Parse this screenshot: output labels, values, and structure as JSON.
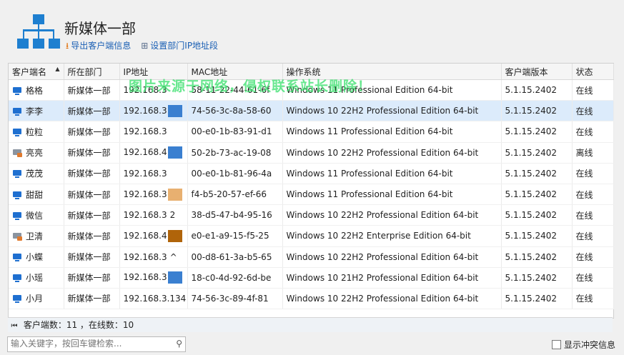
{
  "header": {
    "title": "新媒体一部",
    "export_label": "导出客户端信息",
    "ip_segment_label": "设置部门IP地址段"
  },
  "table": {
    "columns": [
      "客户端名",
      "所在部门",
      "IP地址",
      "MAC地址",
      "操作系统",
      "客户端版本",
      "状态"
    ],
    "rows": [
      {
        "name": "格格",
        "dept": "新媒体一部",
        "ip": "192.168.3",
        "mac": "58-11-22-44-61-6f",
        "os": "Windows 11 Professional Edition 64-bit",
        "ver": "5.1.15.2402",
        "status": "在线",
        "online": true,
        "mask": "",
        "ip_tail": ""
      },
      {
        "name": "李李",
        "dept": "新媒体一部",
        "ip": "192.168.3",
        "mac": "74-56-3c-8a-58-60",
        "os": "Windows 10 22H2 Professional Edition 64-bit",
        "ver": "5.1.15.2402",
        "status": "在线",
        "online": true,
        "mask": "#3a7fd0",
        "ip_tail": ""
      },
      {
        "name": "粒粒",
        "dept": "新媒体一部",
        "ip": "192.168.3",
        "mac": "00-e0-1b-83-91-d1",
        "os": "Windows 11 Professional Edition 64-bit",
        "ver": "5.1.15.2402",
        "status": "在线",
        "online": true,
        "mask": "",
        "ip_tail": ""
      },
      {
        "name": "亮亮",
        "dept": "新媒体一部",
        "ip": "192.168.4",
        "mac": "50-2b-73-ac-19-08",
        "os": "Windows 10 22H2 Professional Edition 64-bit",
        "ver": "5.1.15.2402",
        "status": "离线",
        "online": false,
        "mask": "#3a7fd0",
        "ip_tail": ""
      },
      {
        "name": "茂茂",
        "dept": "新媒体一部",
        "ip": "192.168.3",
        "mac": "00-e0-1b-81-96-4a",
        "os": "Windows 11 Professional Edition 64-bit",
        "ver": "5.1.15.2402",
        "status": "在线",
        "online": true,
        "mask": "",
        "ip_tail": ""
      },
      {
        "name": "甜甜",
        "dept": "新媒体一部",
        "ip": "192.168.3",
        "mac": "f4-b5-20-57-ef-66",
        "os": "Windows 11 Professional Edition 64-bit",
        "ver": "5.1.15.2402",
        "status": "在线",
        "online": true,
        "mask": "#e8b070",
        "ip_tail": ""
      },
      {
        "name": "微信",
        "dept": "新媒体一部",
        "ip": "192.168.3",
        "mac": "38-d5-47-b4-95-16",
        "os": "Windows 10 22H2 Professional Edition 64-bit",
        "ver": "5.1.15.2402",
        "status": "在线",
        "online": true,
        "mask": "",
        "ip_tail": "2"
      },
      {
        "name": "卫清",
        "dept": "新媒体一部",
        "ip": "192.168.4",
        "mac": "e0-e1-a9-15-f5-25",
        "os": "Windows 10 22H2 Enterprise Edition 64-bit",
        "ver": "5.1.15.2402",
        "status": "在线",
        "online": false,
        "mask": "#b0640a",
        "ip_tail": ""
      },
      {
        "name": "小蝶",
        "dept": "新媒体一部",
        "ip": "192.168.3",
        "mac": "00-d8-61-3a-b5-65",
        "os": "Windows 10 22H2 Professional Edition 64-bit",
        "ver": "5.1.15.2402",
        "status": "在线",
        "online": true,
        "mask": "",
        "ip_tail": "^"
      },
      {
        "name": "小瑶",
        "dept": "新媒体一部",
        "ip": "192.168.3",
        "mac": "18-c0-4d-92-6d-be",
        "os": "Windows 10 21H2 Professional Edition 64-bit",
        "ver": "5.1.15.2402",
        "status": "在线",
        "online": true,
        "mask": "#3a7fd0",
        "ip_tail": ""
      },
      {
        "name": "小月",
        "dept": "新媒体一部",
        "ip": "192.168.3.134",
        "mac": "74-56-3c-89-4f-81",
        "os": "Windows 10 22H2 Professional Edition 64-bit",
        "ver": "5.1.15.2402",
        "status": "在线",
        "online": true,
        "mask": "",
        "ip_tail": ""
      }
    ],
    "selected_index": 1
  },
  "footer": {
    "summary": "客户端数：11 ，在线数：10",
    "search_placeholder": "输入关键字，按回车键检索...",
    "conflict_label": "显示冲突信息"
  },
  "watermark": "图片来源于网络，侵权联系站长删除！",
  "colors": {
    "accent": "#1e6fd0",
    "selected_row": "#dcebfb"
  }
}
